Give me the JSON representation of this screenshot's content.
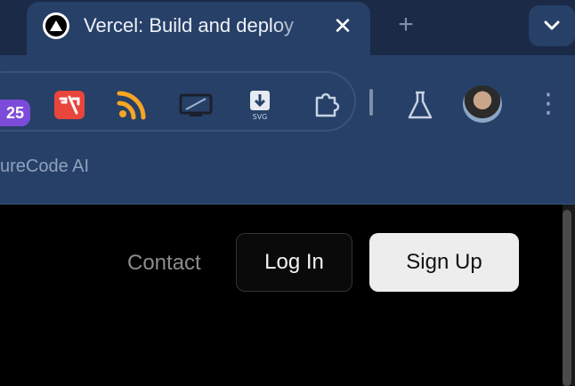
{
  "browser": {
    "tab": {
      "title": "Vercel: Build and deploy",
      "close_glyph": "✕"
    },
    "new_tab_glyph": "+",
    "extensions": [
      {
        "name": "badge-extension",
        "badge": "25"
      },
      {
        "name": "pdf-extension-icon"
      },
      {
        "name": "rss-icon"
      },
      {
        "name": "screen-cast-icon"
      },
      {
        "name": "svg-download-icon"
      },
      {
        "name": "puzzle-extensions-icon"
      },
      {
        "name": "flask-icon"
      }
    ],
    "menu_glyph": "⋮",
    "bookmark": {
      "label": "ureCode AI"
    }
  },
  "page": {
    "nav": {
      "contact": "Contact",
      "login": "Log In",
      "signup": "Sign Up"
    }
  },
  "colors": {
    "tabstrip": "#1a2a47",
    "toolbar": "#274068",
    "page_bg": "#000000",
    "signup_bg": "#ededed"
  }
}
